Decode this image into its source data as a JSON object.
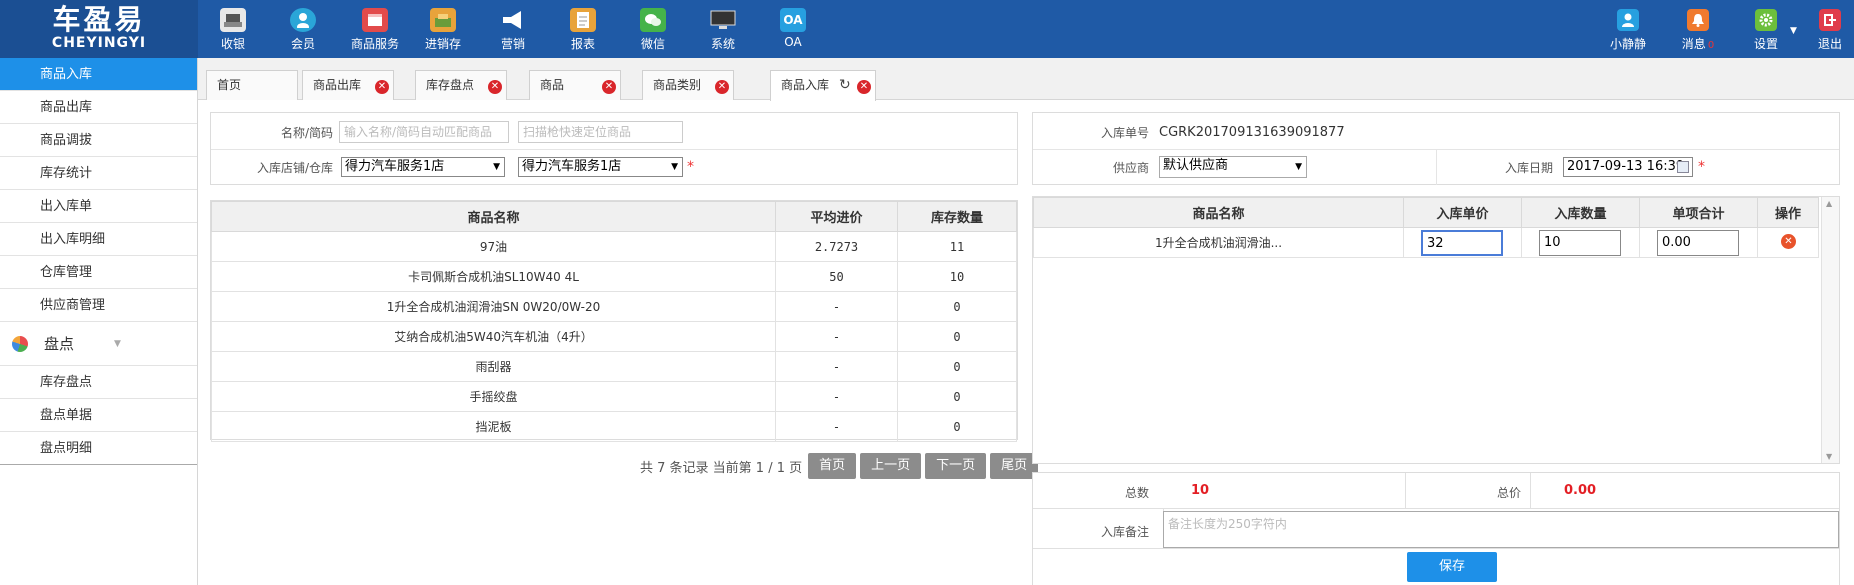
{
  "brand": {
    "cn": "车盈易",
    "en": "CHEYINGYI"
  },
  "top_nav": [
    {
      "label": "收银",
      "icon": "cash-register-icon",
      "color": "#ffffff"
    },
    {
      "label": "会员",
      "icon": "member-icon",
      "color": "#2aa6d8"
    },
    {
      "label": "商品服务",
      "icon": "product-service-icon",
      "color": "#e24b4b"
    },
    {
      "label": "进销存",
      "icon": "inventory-icon",
      "color": "#e8a33b"
    },
    {
      "label": "营销",
      "icon": "marketing-icon",
      "color": "#ffffff"
    },
    {
      "label": "报表",
      "icon": "report-icon",
      "color": "#e8a33b"
    },
    {
      "label": "微信",
      "icon": "wechat-icon",
      "color": "#45b34a"
    },
    {
      "label": "系统",
      "icon": "system-icon",
      "color": "#444444"
    },
    {
      "label": "OA",
      "icon": "oa-icon",
      "color": "#27a0e0",
      "glyph": "OA"
    }
  ],
  "user_nav": [
    {
      "label": "小静静",
      "icon": "user-icon",
      "color": "#27a0e0"
    },
    {
      "label": "消息",
      "icon": "bell-icon",
      "color": "#f07a2e",
      "badge": "0"
    },
    {
      "label": "设置",
      "icon": "gear-icon",
      "color": "#6cbf3c"
    },
    {
      "label": "退出",
      "icon": "logout-icon",
      "color": "#e03c4b"
    }
  ],
  "sidebar": {
    "items": [
      "商品入库",
      "商品出库",
      "商品调拔",
      "库存统计",
      "出入库单",
      "出入库明细",
      "仓库管理",
      "供应商管理"
    ],
    "group": "盘点",
    "group_items": [
      "库存盘点",
      "盘点单据",
      "盘点明细"
    ]
  },
  "tabs": [
    "首页",
    "商品出库",
    "库存盘点",
    "商品",
    "商品类别",
    "商品入库"
  ],
  "search": {
    "label": "名称/简码",
    "name_placeholder": "输入名称/简码自动匹配商品",
    "scan_placeholder": "扫描枪快速定位商品",
    "store_label": "入库店铺/仓库",
    "store_value": "得力汽车服务1店",
    "warehouse_value": "得力汽车服务1店"
  },
  "stock_table": {
    "headers": [
      "商品名称",
      "平均进价",
      "库存数量"
    ],
    "rows": [
      [
        "97油",
        "2.7273",
        "11"
      ],
      [
        "卡司佩斯合成机油SL10W40 4L",
        "50",
        "10"
      ],
      [
        "1升全合成机油润滑油SN 0W20/0W-20",
        "-",
        "0"
      ],
      [
        "艾纳合成机油5W40汽车机油（4升）",
        "-",
        "0"
      ],
      [
        "雨刮器",
        "-",
        "0"
      ],
      [
        "手摇绞盘",
        "-",
        "0"
      ],
      [
        "挡泥板",
        "-",
        "0"
      ]
    ]
  },
  "pager": {
    "summary": "共 7 条记录 当前第 1 / 1 页",
    "first": "首页",
    "prev": "上一页",
    "next": "下一页",
    "last": "尾页"
  },
  "order": {
    "no_label": "入库单号",
    "no_value": "CGRK201709131639091877",
    "supplier_label": "供应商",
    "supplier_value": "默认供应商",
    "date_label": "入库日期",
    "date_value": "2017-09-13 16:39"
  },
  "order_table": {
    "headers": [
      "商品名称",
      "入库单价",
      "入库数量",
      "单项合计",
      "操作"
    ],
    "row": {
      "name": "1升全合成机油润滑油...",
      "price": "32",
      "qty": "10",
      "subtotal": "0.00"
    }
  },
  "totals": {
    "count_label": "总数",
    "count_value": "10",
    "price_label": "总价",
    "price_value": "0.00"
  },
  "remark": {
    "label": "入库备注",
    "placeholder": "备注长度为250字符内"
  },
  "save_label": "保存"
}
